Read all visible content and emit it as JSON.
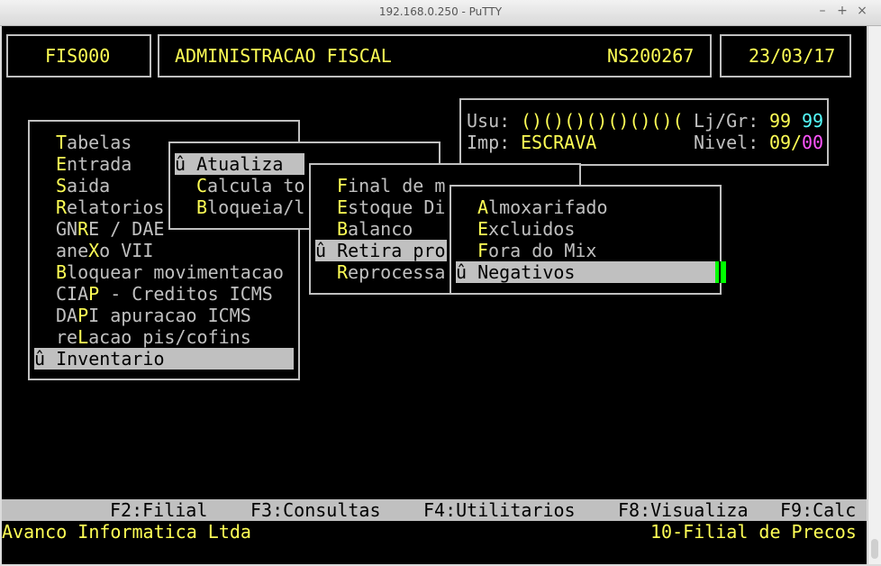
{
  "window": {
    "title": "192.168.0.250 - PuTTY"
  },
  "header": {
    "code": "FIS000",
    "system": "ADMINISTRACAO FISCAL",
    "serial": "NS200267",
    "date": "23/03/17"
  },
  "info": {
    "usu_label": "Usu:",
    "usu_value": "()()()()()()()(",
    "ljgr_label": "Lj/Gr:",
    "lj": "99",
    "gr": "99",
    "imp_label": "Imp:",
    "imp_value": "ESCRAVA",
    "nivel_label": "Nivel:",
    "nivel_a": "09",
    "nivel_sep": "/",
    "nivel_b": "00"
  },
  "menu1": [
    {
      "hot": "T",
      "rest": "abelas"
    },
    {
      "hot": "E",
      "rest": "ntrada"
    },
    {
      "hot": "S",
      "rest": "aida"
    },
    {
      "hot": "R",
      "rest": "elatorios"
    },
    {
      "pre": "GN",
      "hot": "R",
      "rest": "E / DAE"
    },
    {
      "pre": "ane",
      "hot": "X",
      "rest": "o VII"
    },
    {
      "hot": "B",
      "rest": "loquear movimentacao"
    },
    {
      "pre": "CIA",
      "hot": "P",
      "rest": " - Creditos ICMS"
    },
    {
      "pre": "DA",
      "hot": "P",
      "rest": "I apuracao ICMS"
    },
    {
      "pre": "re",
      "hot": "L",
      "rest": "acao pis/cofins"
    },
    {
      "selected": "û Inventario"
    }
  ],
  "menu2": [
    {
      "selected": "û Atualiza"
    },
    {
      "hot": "C",
      "rest": "alcula to"
    },
    {
      "hot": "B",
      "rest": "loqueia/l"
    }
  ],
  "menu3": [
    {
      "hot": "F",
      "rest": "inal de m"
    },
    {
      "hot": "E",
      "rest": "stoque Di"
    },
    {
      "hot": "B",
      "rest": "alanco"
    },
    {
      "selected": "û Retira pro"
    },
    {
      "hot": "R",
      "rest": "eprocessa"
    }
  ],
  "menu4": [
    {
      "hot": "A",
      "rest": "lmoxarifado"
    },
    {
      "hot": "E",
      "rest": "xcluidos"
    },
    {
      "hot": "F",
      "rest": "ora do Mix"
    },
    {
      "selected": "û Negativos"
    }
  ],
  "fkeys": [
    "F2:Filial",
    "F3:Consultas",
    "F4:Utilitarios",
    "F8:Visualiza",
    "F9:Calc"
  ],
  "status": {
    "left": "Avanco Informatica Ltda",
    "right": "10-Filial de Precos"
  }
}
